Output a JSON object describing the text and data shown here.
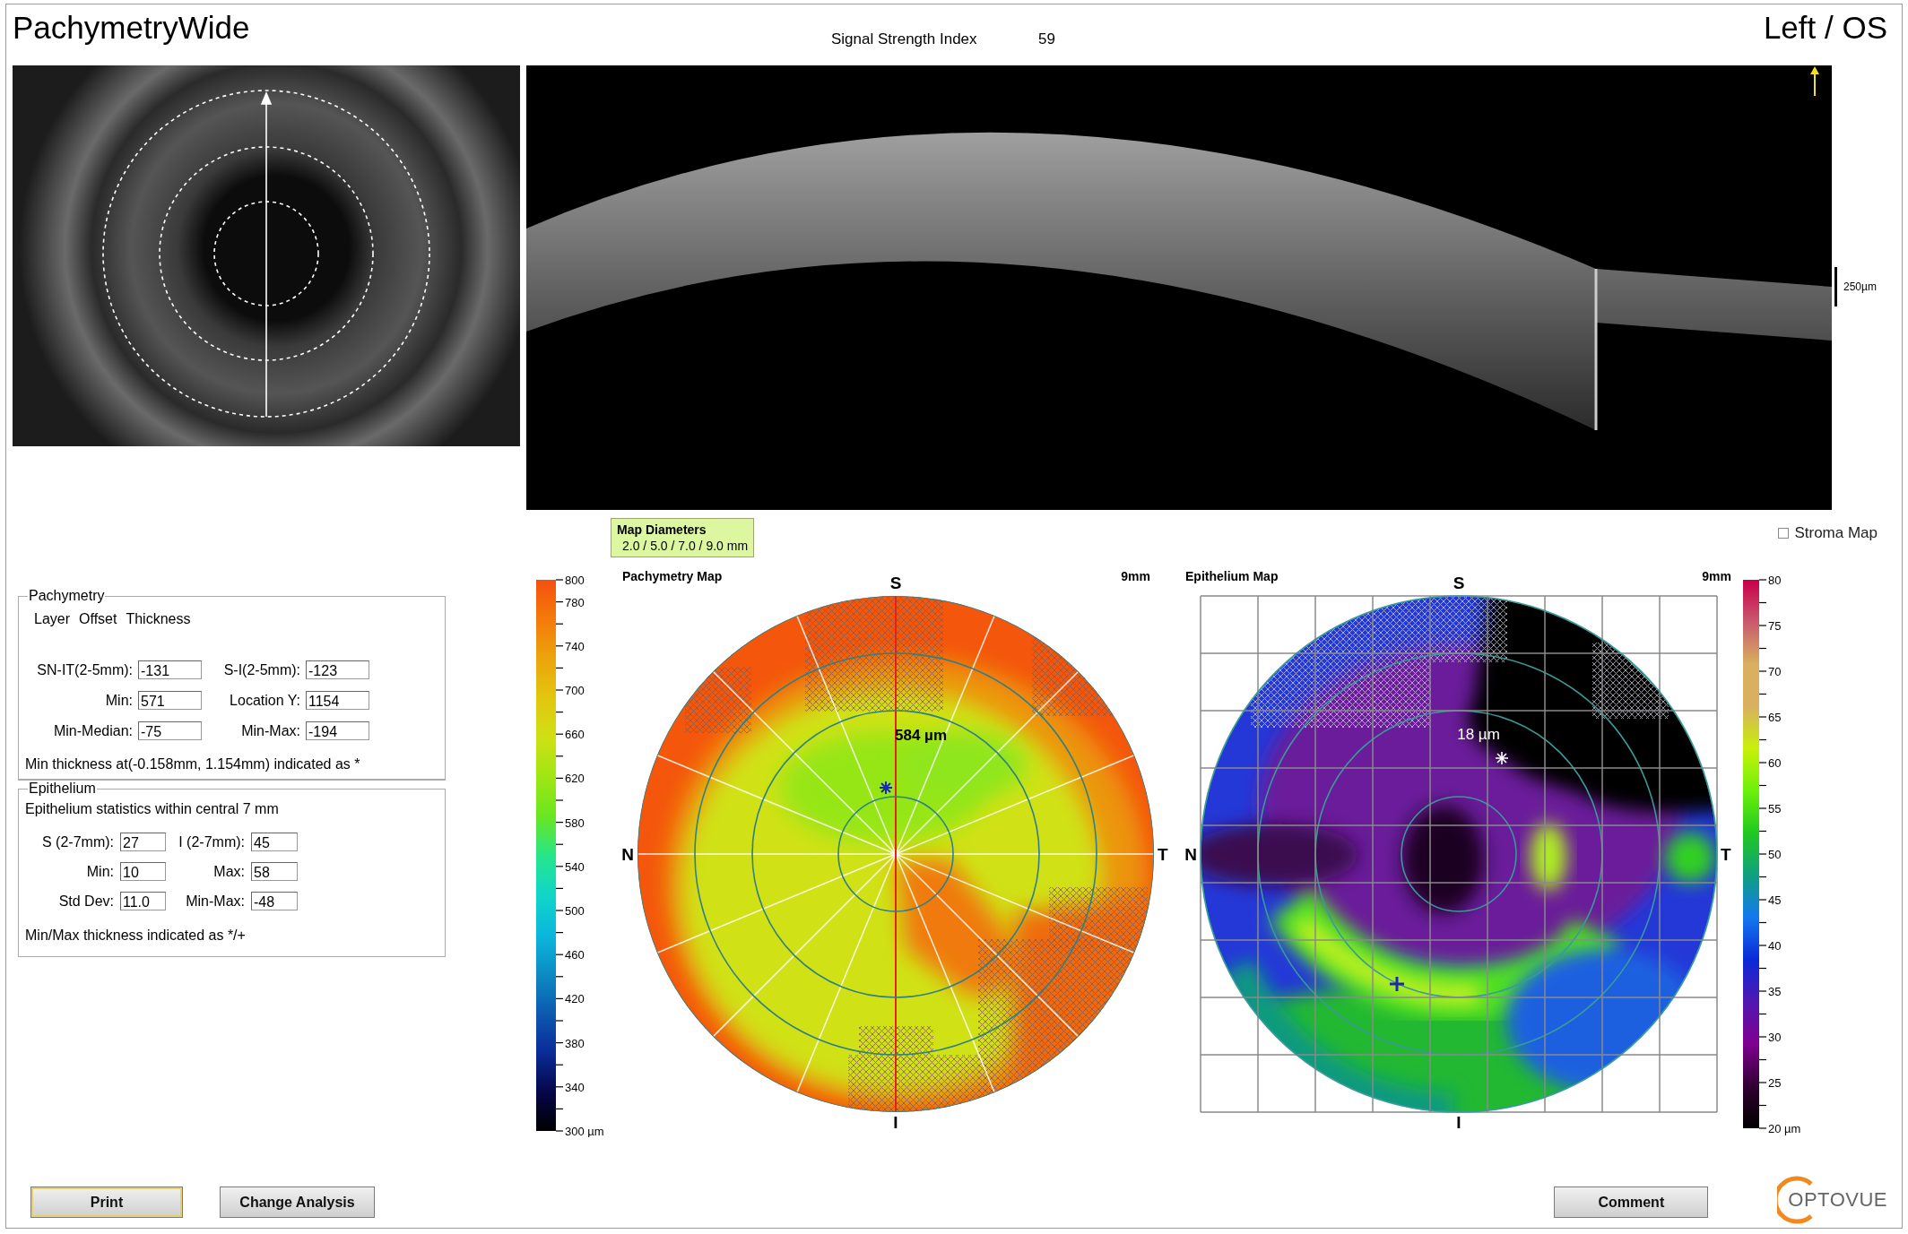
{
  "header": {
    "title": "PachymetryWide",
    "signal_label": "Signal Strength Index",
    "signal_value": "59",
    "eye": "Left / OS"
  },
  "scan": {
    "scale_label": "250µm"
  },
  "pachymetry_panel": {
    "legend": "Pachymetry",
    "columns": [
      "Layer",
      "Offset",
      "Thickness"
    ],
    "fields": [
      {
        "label": "SN-IT(2-5mm):",
        "value": "-131"
      },
      {
        "label": "S-I(2-5mm):",
        "value": "-123"
      },
      {
        "label": "Min:",
        "value": "571"
      },
      {
        "label": "Location Y:",
        "value": "1154"
      },
      {
        "label": "Min-Median:",
        "value": "-75"
      },
      {
        "label": "Min-Max:",
        "value": "-194"
      }
    ],
    "note": "Min thickness at(-0.158mm, 1.154mm) indicated as *"
  },
  "epithelium_panel": {
    "legend": "Epithelium",
    "summary": "Epithelium statistics within central 7 mm",
    "fields": [
      {
        "label": "S (2-7mm):",
        "value": "27"
      },
      {
        "label": "I (2-7mm):",
        "value": "45"
      },
      {
        "label": "Min:",
        "value": "10"
      },
      {
        "label": "Max:",
        "value": "58"
      },
      {
        "label": "Std Dev:",
        "value": "11.0"
      },
      {
        "label": "Min-Max:",
        "value": "-48"
      }
    ],
    "note": "Min/Max thickness indicated as */+"
  },
  "map_diameters": {
    "title": "Map Diameters",
    "value": "2.0 / 5.0 / 7.0 / 9.0 mm"
  },
  "stroma_map": {
    "label": "Stroma Map",
    "checked": false
  },
  "pachymetry_map": {
    "title": "Pachymetry Map",
    "size": "9mm",
    "directions": [
      "S",
      "N",
      "T",
      "I"
    ],
    "center_value": "584 µm",
    "scale_labels": [
      "800",
      "780",
      "740",
      "700",
      "660",
      "620",
      "580",
      "540",
      "500",
      "460",
      "420",
      "380",
      "340",
      "300 µm"
    ]
  },
  "epithelium_map": {
    "title": "Epithelium Map",
    "size": "9mm",
    "directions": [
      "S",
      "N",
      "T",
      "I"
    ],
    "center_value": "18 µm",
    "scale_labels": [
      "80",
      "75",
      "70",
      "65",
      "60",
      "55",
      "50",
      "45",
      "40",
      "35",
      "30",
      "25",
      "20 µm"
    ]
  },
  "left_buttons": [
    {
      "label": "Print",
      "focused": true
    },
    {
      "label": "Change Analysis",
      "focused": false
    }
  ],
  "right_buttons": [
    {
      "label": "Comment",
      "focused": false
    }
  ],
  "logo": {
    "text": "OPTOVUE"
  }
}
